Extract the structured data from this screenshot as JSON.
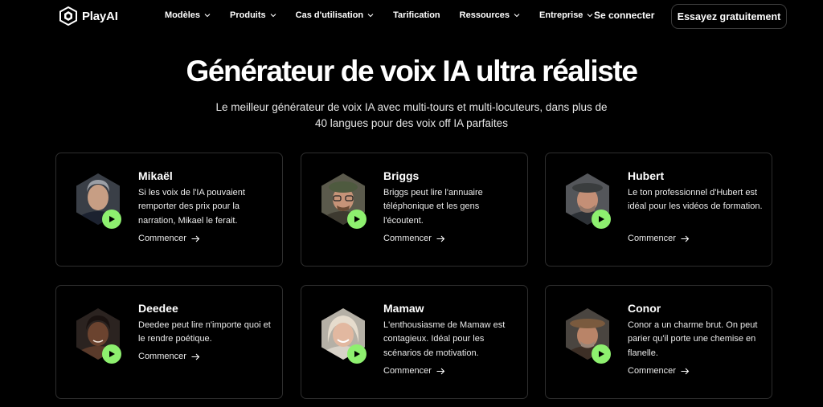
{
  "brand": {
    "name": "PlayAI",
    "logo_icon": "cube-logo-icon"
  },
  "nav": {
    "items": [
      {
        "label": "Modèles",
        "has_dropdown": true
      },
      {
        "label": "Produits",
        "has_dropdown": true
      },
      {
        "label": "Cas d'utilisation",
        "has_dropdown": true
      },
      {
        "label": "Tarification",
        "has_dropdown": false
      },
      {
        "label": "Ressources",
        "has_dropdown": true
      },
      {
        "label": "Entreprise",
        "has_dropdown": true
      }
    ],
    "signin_label": "Se connecter",
    "cta_label": "Essayez gratuitement"
  },
  "hero": {
    "title": "Générateur de voix IA ultra réaliste",
    "subtitle": "Le meilleur générateur de voix IA avec multi-tours et multi-locuteurs, dans plus de 40 langues pour des voix off IA parfaites"
  },
  "voices": [
    {
      "name": "Mikaël",
      "description": "Si les voix de l'IA pouvaient remporter des prix pour la narration, Mikael le ferait.",
      "link_label": "Commencer"
    },
    {
      "name": "Briggs",
      "description": "Briggs peut lire l'annuaire téléphonique et les gens l'écoutent.",
      "link_label": "Commencer"
    },
    {
      "name": "Hubert",
      "description": "Le ton professionnel d'Hubert est idéal pour les vidéos de formation.",
      "link_label": "Commencer"
    },
    {
      "name": "Deedee",
      "description": "Deedee peut lire n'importe quoi et le rendre poétique.",
      "link_label": "Commencer"
    },
    {
      "name": "Mamaw",
      "description": "L'enthousiasme de Mamaw est contagieux. Idéal pour les scénarios de motivation.",
      "link_label": "Commencer"
    },
    {
      "name": "Conor",
      "description": "Conor a un charme brut. On peut parier qu'il porte une chemise en flanelle.",
      "link_label": "Commencer"
    }
  ],
  "colors": {
    "background": "#000000",
    "play_button": "#8ef06f",
    "card_border": "#2e2e2e"
  }
}
